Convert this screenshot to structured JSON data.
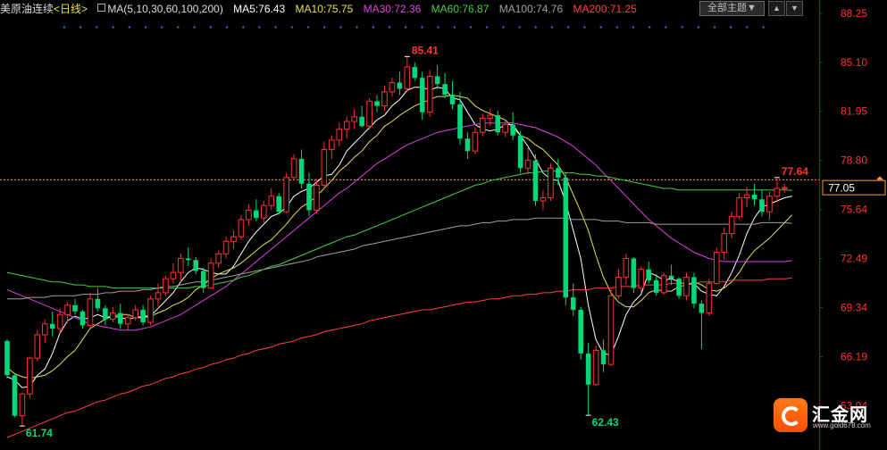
{
  "header": {
    "title": "美原油连续",
    "period": "<日线>",
    "ma_label": "MA(5,10,30,60,100,200)",
    "ma_values": [
      {
        "label": "MA5:76.43",
        "color": "#ffffff"
      },
      {
        "label": "MA10:75.75",
        "color": "#e8e050"
      },
      {
        "label": "MA30:72.36",
        "color": "#e040e0"
      },
      {
        "label": "MA60:76.87",
        "color": "#40d040"
      },
      {
        "label": "MA100:74.76",
        "color": "#a0a0a0"
      },
      {
        "label": "MA200:71.25",
        "color": "#ff4040"
      }
    ],
    "theme_button": "全部主题▼",
    "tool_up": "▲",
    "tool_down": "▼"
  },
  "logo": {
    "name": "汇金网",
    "url": "www.gold678.com"
  },
  "colors": {
    "up": "#ff3232",
    "down": "#00d77a",
    "bg": "#000000",
    "grid_text": "#ff3232",
    "current_price": "#ff9a40"
  },
  "chart_data": {
    "type": "candlestick",
    "title": "美原油连续",
    "ylim": [
      60.2,
      89.1
    ],
    "yticks": [
      88.25,
      85.1,
      81.95,
      78.8,
      75.64,
      72.49,
      69.34,
      66.19,
      63.04
    ],
    "current_price": 77.05,
    "annotations": [
      {
        "text": "85.41",
        "value": 85.41,
        "kind": "high"
      },
      {
        "text": "61.74",
        "value": 61.74,
        "kind": "low"
      },
      {
        "text": "62.43",
        "value": 62.43,
        "kind": "low"
      },
      {
        "text": "77.64",
        "value": 77.64,
        "kind": "high"
      }
    ],
    "candles": [
      [
        67.2,
        67.3,
        64.8,
        65.0
      ],
      [
        65.0,
        65.1,
        62.3,
        62.4
      ],
      [
        62.4,
        63.9,
        61.74,
        63.8
      ],
      [
        63.8,
        66.2,
        63.5,
        66.1
      ],
      [
        66.1,
        67.9,
        65.9,
        67.6
      ],
      [
        67.6,
        68.6,
        67.1,
        68.3
      ],
      [
        68.3,
        69.1,
        67.5,
        68.0
      ],
      [
        68.0,
        69.3,
        67.7,
        68.9
      ],
      [
        68.9,
        69.7,
        68.4,
        69.5
      ],
      [
        69.5,
        69.9,
        68.9,
        69.1
      ],
      [
        69.1,
        69.2,
        68.0,
        68.2
      ],
      [
        68.2,
        70.3,
        68.0,
        69.9
      ],
      [
        69.9,
        70.6,
        69.1,
        69.3
      ],
      [
        69.3,
        69.5,
        68.2,
        68.6
      ],
      [
        68.6,
        69.4,
        68.4,
        69.0
      ],
      [
        69.0,
        69.6,
        68.0,
        68.3
      ],
      [
        68.3,
        68.9,
        67.9,
        68.7
      ],
      [
        68.7,
        69.5,
        68.5,
        69.2
      ],
      [
        69.2,
        69.5,
        68.2,
        68.4
      ],
      [
        68.4,
        70.1,
        68.2,
        69.9
      ],
      [
        69.9,
        70.9,
        69.4,
        70.3
      ],
      [
        70.3,
        71.4,
        70.1,
        71.2
      ],
      [
        71.2,
        72.2,
        70.9,
        71.6
      ],
      [
        71.6,
        72.8,
        71.0,
        72.5
      ],
      [
        72.5,
        73.2,
        72.0,
        72.4
      ],
      [
        72.4,
        72.6,
        71.5,
        71.7
      ],
      [
        71.7,
        71.9,
        70.3,
        70.6
      ],
      [
        70.6,
        72.5,
        70.5,
        72.2
      ],
      [
        72.2,
        73.0,
        71.9,
        72.8
      ],
      [
        72.8,
        73.9,
        72.5,
        73.6
      ],
      [
        73.6,
        74.3,
        73.1,
        73.9
      ],
      [
        73.9,
        75.3,
        73.7,
        75.0
      ],
      [
        75.0,
        76.0,
        74.6,
        75.6
      ],
      [
        75.6,
        76.3,
        74.9,
        75.1
      ],
      [
        75.1,
        76.2,
        74.8,
        75.9
      ],
      [
        75.9,
        77.0,
        75.6,
        76.5
      ],
      [
        76.5,
        76.7,
        75.3,
        75.5
      ],
      [
        75.5,
        78.0,
        75.4,
        77.7
      ],
      [
        77.7,
        79.2,
        77.5,
        78.9
      ],
      [
        78.9,
        79.5,
        77.0,
        77.3
      ],
      [
        77.3,
        78.0,
        75.2,
        75.6
      ],
      [
        75.6,
        77.6,
        75.4,
        77.2
      ],
      [
        77.2,
        80.0,
        77.0,
        79.5
      ],
      [
        79.5,
        80.4,
        78.9,
        80.1
      ],
      [
        80.1,
        81.2,
        79.7,
        80.8
      ],
      [
        80.8,
        81.6,
        80.2,
        81.3
      ],
      [
        81.3,
        82.1,
        80.8,
        81.6
      ],
      [
        81.6,
        82.3,
        80.9,
        81.0
      ],
      [
        81.0,
        82.8,
        80.8,
        82.6
      ],
      [
        82.6,
        83.0,
        81.9,
        82.3
      ],
      [
        82.3,
        83.6,
        82.0,
        83.2
      ],
      [
        83.2,
        84.1,
        82.9,
        83.8
      ],
      [
        83.8,
        84.5,
        83.0,
        83.4
      ],
      [
        83.4,
        85.41,
        83.2,
        84.8
      ],
      [
        84.8,
        85.1,
        83.9,
        84.1
      ],
      [
        84.1,
        84.5,
        81.4,
        81.9
      ],
      [
        81.9,
        84.6,
        81.6,
        84.2
      ],
      [
        84.2,
        84.9,
        83.4,
        83.7
      ],
      [
        83.7,
        84.4,
        82.8,
        83.0
      ],
      [
        83.0,
        83.9,
        82.1,
        82.4
      ],
      [
        82.4,
        83.2,
        79.8,
        80.2
      ],
      [
        80.2,
        80.6,
        78.9,
        79.4
      ],
      [
        79.4,
        80.9,
        79.2,
        80.6
      ],
      [
        80.6,
        81.8,
        80.4,
        81.5
      ],
      [
        81.5,
        82.1,
        81.0,
        81.7
      ],
      [
        81.7,
        82.0,
        80.4,
        80.6
      ],
      [
        80.6,
        81.4,
        80.3,
        81.1
      ],
      [
        81.1,
        81.9,
        80.1,
        80.4
      ],
      [
        80.4,
        80.7,
        78.0,
        78.3
      ],
      [
        78.3,
        79.6,
        77.9,
        78.8
      ],
      [
        78.8,
        79.2,
        75.9,
        76.2
      ],
      [
        76.2,
        76.9,
        75.6,
        76.4
      ],
      [
        76.4,
        78.6,
        76.2,
        78.3
      ],
      [
        78.3,
        78.9,
        77.2,
        77.7
      ],
      [
        77.7,
        78.0,
        69.5,
        70.0
      ],
      [
        70.0,
        70.9,
        68.8,
        69.2
      ],
      [
        69.2,
        69.4,
        66.0,
        66.4
      ],
      [
        66.4,
        67.1,
        62.43,
        64.4
      ],
      [
        64.4,
        66.9,
        64.3,
        66.6
      ],
      [
        66.6,
        67.3,
        65.2,
        65.7
      ],
      [
        65.7,
        70.5,
        65.6,
        70.1
      ],
      [
        70.1,
        71.8,
        69.9,
        71.3
      ],
      [
        71.3,
        72.8,
        70.8,
        72.5
      ],
      [
        72.5,
        72.6,
        70.3,
        70.6
      ],
      [
        70.6,
        72.0,
        70.3,
        71.8
      ],
      [
        71.8,
        72.3,
        70.9,
        71.1
      ],
      [
        71.1,
        71.5,
        70.1,
        70.3
      ],
      [
        70.3,
        71.6,
        70.2,
        71.4
      ],
      [
        71.4,
        72.1,
        70.8,
        71.2
      ],
      [
        71.2,
        71.3,
        69.9,
        70.1
      ],
      [
        70.1,
        71.6,
        69.8,
        71.3
      ],
      [
        71.3,
        71.6,
        69.3,
        69.6
      ],
      [
        69.6,
        69.8,
        66.7,
        69.0
      ],
      [
        69.0,
        71.2,
        68.8,
        70.9
      ],
      [
        70.9,
        73.2,
        70.8,
        72.9
      ],
      [
        72.9,
        74.5,
        72.4,
        74.1
      ],
      [
        74.1,
        75.5,
        73.8,
        75.2
      ],
      [
        75.2,
        76.7,
        75.0,
        76.4
      ],
      [
        76.4,
        77.1,
        75.8,
        76.6
      ],
      [
        76.6,
        77.3,
        75.9,
        76.3
      ],
      [
        76.3,
        76.9,
        75.2,
        75.5
      ],
      [
        75.5,
        76.8,
        75.0,
        76.5
      ],
      [
        76.5,
        77.64,
        76.1,
        77.0
      ],
      [
        77.0,
        77.3,
        76.7,
        77.05
      ]
    ],
    "ma_series": [
      {
        "name": "MA5",
        "values": [
          64.9,
          64.7,
          64.2,
          64.3,
          65.0,
          65.4,
          66.4,
          67.7,
          68.5,
          68.8,
          68.6,
          68.7,
          68.9,
          68.7,
          68.8,
          68.7,
          68.6,
          68.7,
          68.7,
          68.8,
          69.3,
          69.8,
          70.3,
          71.0,
          71.6,
          71.9,
          71.8,
          71.6,
          71.5,
          71.5,
          72.0,
          72.8,
          73.6,
          74.2,
          74.7,
          75.2,
          75.4,
          75.8,
          76.5,
          76.8,
          77.0,
          77.4,
          77.8,
          77.9,
          78.5,
          79.4,
          79.9,
          80.4,
          80.9,
          81.4,
          81.7,
          82.3,
          82.7,
          83.3,
          83.5,
          83.5,
          83.3,
          83.5,
          83.4,
          82.8,
          82.7,
          81.9,
          81.1,
          80.8,
          80.7,
          80.8,
          81.1,
          81.1,
          80.4,
          79.7,
          78.9,
          78.0,
          77.6,
          77.5,
          76.1,
          74.3,
          72.5,
          69.5,
          67.3,
          66.4,
          66.3,
          67.5,
          68.9,
          69.7,
          70.2,
          71.6,
          71.4,
          71.1,
          71.2,
          71.0,
          70.8,
          70.9,
          70.4,
          70.2,
          70.1,
          70.7,
          71.6,
          72.7,
          74.1,
          75.1,
          75.8,
          76.0,
          76.2,
          76.4,
          76.5
        ]
      },
      {
        "name": "MA10",
        "values": [
          65.5,
          65.1,
          64.9,
          64.8,
          64.9,
          65.0,
          65.3,
          65.7,
          66.2,
          66.6,
          67.3,
          68.0,
          68.3,
          68.6,
          68.8,
          68.9,
          68.9,
          68.7,
          68.8,
          68.8,
          69.0,
          69.2,
          69.5,
          69.7,
          70.0,
          70.5,
          70.8,
          71.2,
          71.5,
          71.7,
          71.9,
          72.2,
          72.6,
          73.0,
          73.4,
          73.7,
          74.2,
          74.7,
          75.3,
          75.8,
          76.1,
          76.5,
          77.0,
          77.5,
          78.1,
          78.5,
          79.0,
          79.4,
          80.0,
          80.4,
          81.0,
          81.3,
          81.7,
          82.0,
          82.3,
          82.5,
          82.7,
          82.9,
          82.9,
          83.0,
          82.9,
          82.8,
          82.3,
          82.0,
          81.8,
          81.6,
          81.4,
          80.9,
          80.4,
          80.2,
          79.8,
          79.5,
          79.0,
          78.5,
          77.7,
          76.6,
          75.5,
          74.3,
          72.7,
          71.3,
          70.3,
          69.7,
          69.4,
          69.4,
          69.8,
          70.3,
          70.5,
          70.4,
          70.4,
          70.7,
          70.8,
          71.0,
          70.8,
          70.5,
          70.4,
          70.6,
          71.0,
          71.6,
          72.4,
          73.0,
          73.4,
          73.8,
          74.3,
          74.8,
          75.3
        ]
      },
      {
        "name": "MA30",
        "values": [
          70.5,
          70.3,
          70.1,
          69.9,
          69.7,
          69.5,
          69.3,
          69.1,
          68.9,
          68.7,
          68.5,
          68.3,
          68.2,
          68.1,
          68.0,
          67.9,
          67.9,
          67.9,
          68.0,
          68.1,
          68.3,
          68.5,
          68.7,
          68.9,
          69.2,
          69.5,
          69.8,
          70.1,
          70.4,
          70.7,
          71.1,
          71.5,
          71.9,
          72.3,
          72.7,
          73.1,
          73.5,
          73.9,
          74.3,
          74.7,
          75.1,
          75.5,
          75.9,
          76.3,
          76.7,
          77.0,
          77.4,
          77.8,
          78.2,
          78.6,
          78.9,
          79.2,
          79.5,
          79.8,
          80.0,
          80.2,
          80.4,
          80.6,
          80.7,
          80.8,
          80.9,
          81.0,
          81.1,
          81.2,
          81.2,
          81.2,
          81.2,
          81.2,
          81.1,
          81.0,
          80.9,
          80.7,
          80.5,
          80.3,
          80.0,
          79.7,
          79.3,
          78.9,
          78.5,
          78.0,
          77.5,
          77.0,
          76.5,
          76.0,
          75.5,
          75.0,
          74.6,
          74.2,
          73.8,
          73.5,
          73.2,
          72.9,
          72.7,
          72.5,
          72.4,
          72.3,
          72.3,
          72.3,
          72.3,
          72.3,
          72.3,
          72.3,
          72.3,
          72.3,
          72.36
        ]
      },
      {
        "name": "MA60",
        "values": [
          71.6,
          71.5,
          71.4,
          71.3,
          71.2,
          71.1,
          71.0,
          71.0,
          70.9,
          70.8,
          70.8,
          70.7,
          70.7,
          70.7,
          70.6,
          70.6,
          70.6,
          70.6,
          70.6,
          70.6,
          70.6,
          70.6,
          70.6,
          70.6,
          70.6,
          70.7,
          70.7,
          70.8,
          70.9,
          71.0,
          71.1,
          71.3,
          71.4,
          71.6,
          71.8,
          72.0,
          72.1,
          72.3,
          72.5,
          72.7,
          72.9,
          73.1,
          73.3,
          73.5,
          73.7,
          73.9,
          74.0,
          74.2,
          74.4,
          74.6,
          74.8,
          75.0,
          75.2,
          75.4,
          75.6,
          75.8,
          76.0,
          76.2,
          76.4,
          76.6,
          76.8,
          77.0,
          77.2,
          77.3,
          77.5,
          77.6,
          77.7,
          77.8,
          77.9,
          78.0,
          78.0,
          78.1,
          78.1,
          78.1,
          78.0,
          78.0,
          77.9,
          77.9,
          77.8,
          77.8,
          77.7,
          77.6,
          77.5,
          77.4,
          77.3,
          77.2,
          77.1,
          77.0,
          77.0,
          76.9,
          76.9,
          76.9,
          76.9,
          76.9,
          76.9,
          76.9,
          76.9,
          76.9,
          76.9,
          76.9,
          76.9,
          76.9,
          76.9,
          76.9,
          76.87
        ]
      },
      {
        "name": "MA100",
        "values": [
          69.9,
          69.9,
          69.9,
          70.0,
          70.0,
          70.0,
          70.1,
          70.1,
          70.1,
          70.1,
          70.2,
          70.2,
          70.2,
          70.3,
          70.3,
          70.4,
          70.4,
          70.4,
          70.5,
          70.5,
          70.6,
          70.7,
          70.7,
          70.8,
          70.9,
          71.0,
          71.0,
          71.1,
          71.2,
          71.3,
          71.4,
          71.5,
          71.6,
          71.7,
          71.8,
          71.9,
          72.0,
          72.1,
          72.2,
          72.3,
          72.4,
          72.6,
          72.7,
          72.8,
          72.9,
          73.0,
          73.1,
          73.3,
          73.4,
          73.5,
          73.6,
          73.7,
          73.8,
          73.9,
          74.0,
          74.1,
          74.2,
          74.3,
          74.4,
          74.5,
          74.6,
          74.6,
          74.7,
          74.8,
          74.8,
          74.9,
          74.9,
          75.0,
          75.0,
          75.0,
          75.1,
          75.1,
          75.1,
          75.1,
          75.1,
          75.0,
          75.0,
          75.0,
          75.0,
          74.9,
          74.9,
          74.9,
          74.8,
          74.8,
          74.8,
          74.8,
          74.7,
          74.7,
          74.7,
          74.7,
          74.7,
          74.7,
          74.7,
          74.7,
          74.7,
          74.7,
          74.7,
          74.7,
          74.7,
          74.7,
          74.8,
          74.8,
          74.8,
          74.8,
          74.76
        ]
      },
      {
        "name": "MA200",
        "values": [
          61.0,
          61.2,
          61.4,
          61.6,
          61.8,
          62.0,
          62.2,
          62.4,
          62.6,
          62.7,
          62.9,
          63.1,
          63.3,
          63.4,
          63.6,
          63.8,
          63.9,
          64.1,
          64.3,
          64.4,
          64.6,
          64.8,
          64.9,
          65.1,
          65.2,
          65.4,
          65.5,
          65.7,
          65.8,
          66.0,
          66.1,
          66.3,
          66.4,
          66.6,
          66.7,
          66.8,
          67.0,
          67.1,
          67.2,
          67.4,
          67.5,
          67.6,
          67.8,
          67.9,
          68.0,
          68.1,
          68.2,
          68.3,
          68.5,
          68.6,
          68.7,
          68.8,
          68.9,
          69.0,
          69.1,
          69.2,
          69.2,
          69.3,
          69.4,
          69.5,
          69.6,
          69.7,
          69.7,
          69.8,
          69.9,
          69.9,
          70.0,
          70.1,
          70.1,
          70.2,
          70.2,
          70.3,
          70.3,
          70.4,
          70.4,
          70.5,
          70.5,
          70.5,
          70.6,
          70.6,
          70.6,
          70.7,
          70.7,
          70.7,
          70.8,
          70.8,
          70.8,
          70.8,
          70.9,
          70.9,
          70.9,
          70.9,
          71.0,
          71.0,
          71.0,
          71.0,
          71.1,
          71.1,
          71.1,
          71.1,
          71.1,
          71.2,
          71.2,
          71.2,
          71.25
        ]
      }
    ]
  }
}
